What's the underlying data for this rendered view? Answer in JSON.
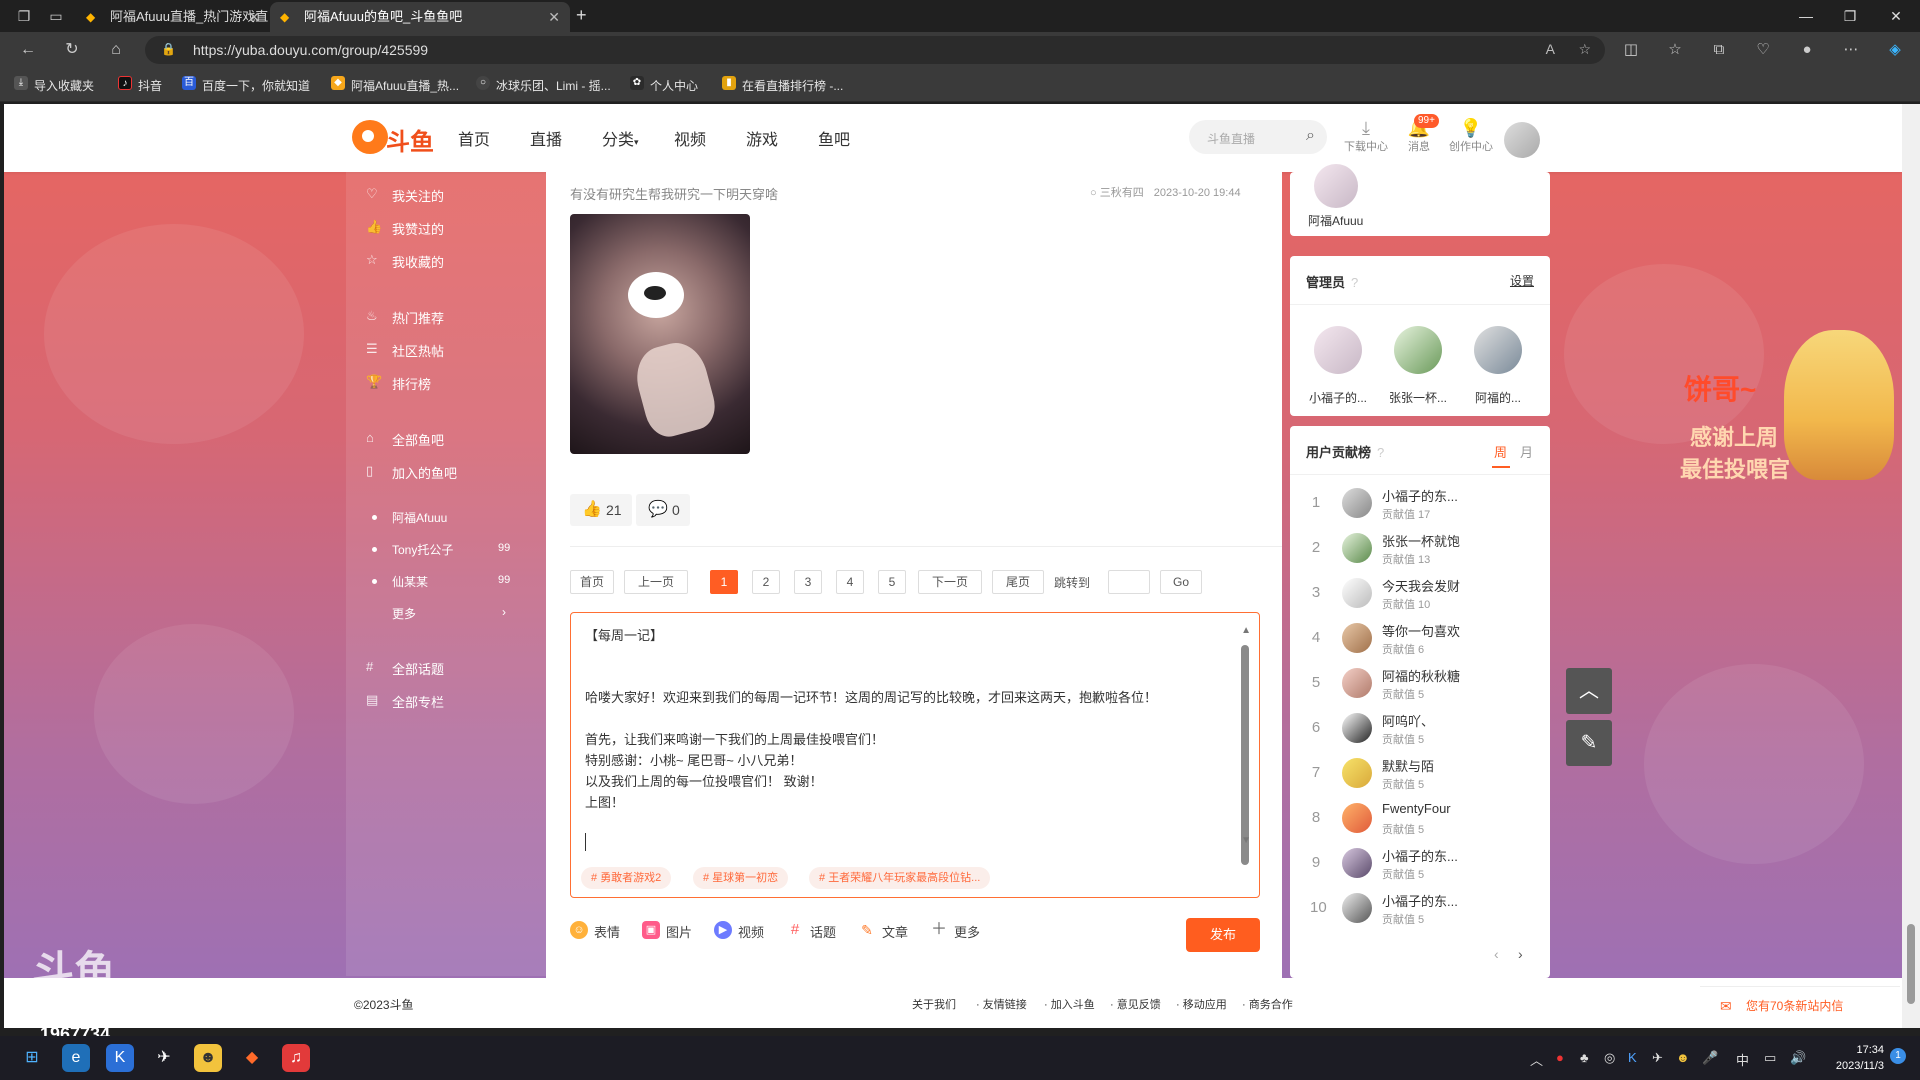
{
  "browser": {
    "tabs": [
      {
        "title": "阿福Afuuu直播_热门游戏直播_斗",
        "active": false
      },
      {
        "title": "阿福Afuuu的鱼吧_斗鱼鱼吧",
        "active": true
      }
    ],
    "url": "https://yuba.douyu.com/group/425599",
    "bookmarks": [
      "导入收藏夹",
      "抖音",
      "百度一下，你就知道",
      "阿福Afuuu直播_热...",
      "冰球乐团、Limi - 摇...",
      "个人中心",
      "在看直播排行榜 -..."
    ]
  },
  "site": {
    "logo_text": "斗鱼",
    "nav": [
      "首页",
      "直播",
      "分类",
      "视频",
      "游戏",
      "鱼吧"
    ],
    "search_placeholder": "斗鱼直播",
    "header_icons": [
      {
        "label": "下载中心",
        "icon": "download-icon"
      },
      {
        "label": "消息",
        "icon": "bell-icon"
      },
      {
        "label": "创作中心",
        "icon": "lightbulb-icon"
      }
    ],
    "badge": "99+"
  },
  "sidebar": {
    "group1": [
      "我关注的",
      "我赞过的",
      "我收藏的"
    ],
    "group2": [
      "热门推荐",
      "社区热帖",
      "排行榜"
    ],
    "group3": [
      "全部鱼吧",
      "加入的鱼吧"
    ],
    "bars": [
      {
        "name": "阿福Afuuu",
        "count": ""
      },
      {
        "name": "Tony托公子",
        "count": "99"
      },
      {
        "name": "仙某某",
        "count": "99"
      }
    ],
    "more": "更多",
    "group4": [
      "全部话题",
      "全部专栏"
    ]
  },
  "post": {
    "question": "有没有研究生帮我研究一下明天穿啥",
    "author": "三秋有四",
    "time": "2023-10-20 19:44",
    "likes": "21",
    "comments": "0"
  },
  "pagination": {
    "first": "首页",
    "prev": "上一页",
    "pages": [
      "1",
      "2",
      "3",
      "4",
      "5"
    ],
    "current": "1",
    "next": "下一页",
    "last": "尾页",
    "jump_label": "跳转到",
    "go": "Go"
  },
  "editor": {
    "lines": [
      "【每周一记】",
      "",
      "哈喽大家好！欢迎来到我们的每周一记环节！这周的周记写的比较晚，才回来这两天，抱歉啦各位！",
      "",
      "首先，让我们来鸣谢一下我们的上周最佳投喂官们！",
      "特别感谢：小桃~   尾巴哥~    小八兄弟！",
      "以及我们上周的每一位投喂官们！  致谢！",
      "上图！"
    ],
    "tags": [
      "勇敢者游戏2",
      "星球第一初恋",
      "王者荣耀八年玩家最高段位钻..."
    ],
    "tools": [
      "表情",
      "图片",
      "视频",
      "话题",
      "文章",
      "更多"
    ],
    "publish": "发布"
  },
  "right": {
    "owner_name": "阿福Afuuu",
    "admins_title": "管理员",
    "admins_setting": "设置",
    "admins": [
      "小福子的...",
      "张张一杯...",
      "阿福的..."
    ],
    "rank_title": "用户贡献榜",
    "rank_tabs": [
      "周",
      "月"
    ],
    "rank_score_label": "贡献值",
    "rank": [
      {
        "n": "1",
        "name": "小福子的东...",
        "score": "17"
      },
      {
        "n": "2",
        "name": "张张一杯就饱",
        "score": "13"
      },
      {
        "n": "3",
        "name": "今天我会发财",
        "score": "10"
      },
      {
        "n": "4",
        "name": "等你一句喜欢",
        "score": "6"
      },
      {
        "n": "5",
        "name": "阿福的秋秋糖",
        "score": "5"
      },
      {
        "n": "6",
        "name": "阿呜吖、",
        "score": "5"
      },
      {
        "n": "7",
        "name": "默默与陌",
        "score": "5"
      },
      {
        "n": "8",
        "name": "FwentyFour",
        "score": "5"
      },
      {
        "n": "9",
        "name": "小福子的东...",
        "score": "5"
      },
      {
        "n": "10",
        "name": "小福子的东...",
        "score": "5"
      }
    ]
  },
  "banner": {
    "line1": "饼哥~",
    "line2": "感谢上周",
    "line3": "最佳投喂官"
  },
  "footer": {
    "copyright": "©2023斗鱼",
    "links": [
      "关于我们",
      "友情链接",
      "加入斗鱼",
      "意见反馈",
      "移动应用",
      "商务合作"
    ],
    "notice": "您有70条新站内信"
  },
  "watermark": {
    "logo": "斗鱼",
    "room": "1967734"
  },
  "taskbar": {
    "time": "17:34",
    "date": "2023/11/3",
    "ime": "中"
  }
}
